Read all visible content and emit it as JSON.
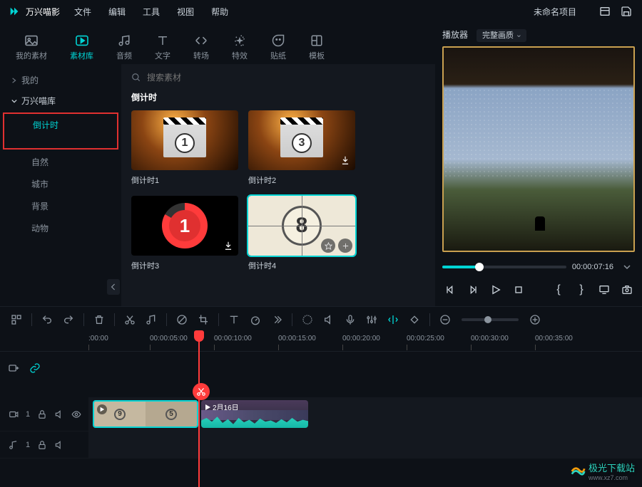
{
  "app": {
    "name": "万兴喵影",
    "project": "未命名项目"
  },
  "menu": {
    "file": "文件",
    "edit": "编辑",
    "tools": "工具",
    "view": "视图",
    "help": "帮助"
  },
  "tabs": {
    "mymedia": "我的素材",
    "library": "素材库",
    "audio": "音频",
    "text": "文字",
    "transition": "转场",
    "effect": "特效",
    "sticker": "贴纸",
    "template": "模板"
  },
  "sidebar": {
    "mine": "我的",
    "wxlib": "万兴喵库",
    "subs": {
      "countdown": "倒计时",
      "nature": "自然",
      "city": "城市",
      "background": "背景",
      "animal": "动物"
    }
  },
  "search": {
    "placeholder": "搜索素材"
  },
  "section": {
    "title": "倒计时"
  },
  "cards": {
    "c1": {
      "num": "1",
      "label": "倒计时1"
    },
    "c2": {
      "num": "3",
      "label": "倒计时2"
    },
    "c3": {
      "num": "1",
      "label": "倒计时3"
    },
    "c4": {
      "num": "8",
      "label": "倒计时4"
    }
  },
  "preview": {
    "title": "播放器",
    "quality": "完整画质",
    "time": "00:00:07:16"
  },
  "ruler": {
    "t0": ":00:00",
    "t1": "00:00:05:00",
    "t2": "00:00:10:00",
    "t3": "00:00:15:00",
    "t4": "00:00:20:00",
    "t5": "00:00:25:00",
    "t6": "00:00:30:00",
    "t7": "00:00:35:00"
  },
  "tracks": {
    "video": {
      "label": "1",
      "clip2_label": "2月16日",
      "thumb_a": "9",
      "thumb_b": "5"
    },
    "audio": {
      "label": "1"
    }
  },
  "watermark": {
    "main": "极光下载站",
    "sub": "www.xz7.com"
  }
}
